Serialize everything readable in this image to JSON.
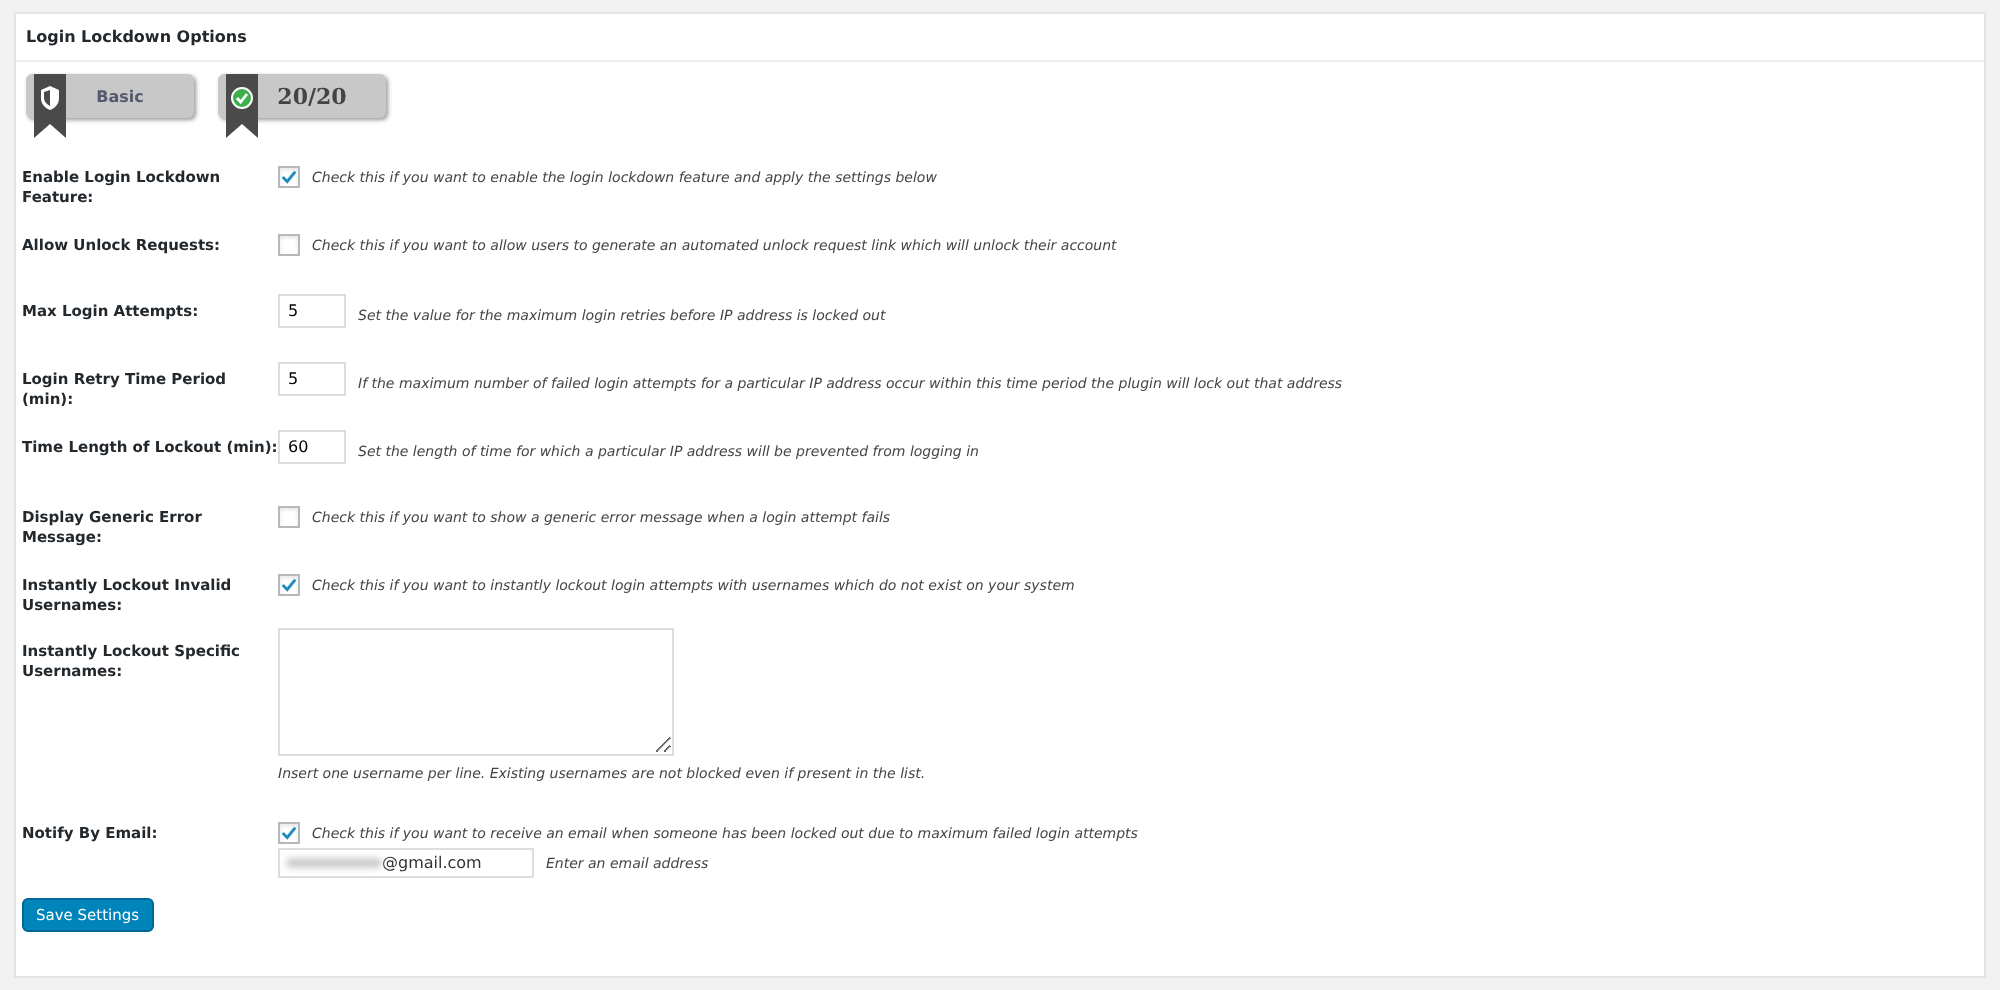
{
  "panel": {
    "title": "Login Lockdown Options"
  },
  "badges": [
    {
      "kind": "shield",
      "label": "Basic"
    },
    {
      "kind": "check",
      "label": "20/20"
    }
  ],
  "rows": [
    {
      "kind": "checkbox",
      "label": "Enable Login Lockdown Feature:",
      "checked": true,
      "description": "Check this if you want to enable the login lockdown feature and apply the settings below"
    },
    {
      "kind": "checkbox",
      "label": "Allow Unlock Requests:",
      "checked": false,
      "description": "Check this if you want to allow users to generate an automated unlock request link which will unlock their account"
    },
    {
      "kind": "number",
      "label": "Max Login Attempts:",
      "value": "5",
      "description": "Set the value for the maximum login retries before IP address is locked out"
    },
    {
      "kind": "number",
      "label": "Login Retry Time Period (min):",
      "value": "5",
      "description": "If the maximum number of failed login attempts for a particular IP address occur within this time period the plugin will lock out that address"
    },
    {
      "kind": "number",
      "label": "Time Length of Lockout (min):",
      "value": "60",
      "description": "Set the length of time for which a particular IP address will be prevented from logging in"
    },
    {
      "kind": "checkbox",
      "label": "Display Generic Error Message:",
      "checked": false,
      "description": "Check this if you want to show a generic error message when a login attempt fails"
    },
    {
      "kind": "checkbox",
      "label": "Instantly Lockout Invalid Usernames:",
      "checked": true,
      "description": "Check this if you want to instantly lockout login attempts with usernames which do not exist on your system"
    },
    {
      "kind": "textarea",
      "label": "Instantly Lockout Specific Usernames:",
      "description": "Insert one username per line. Existing usernames are not blocked even if present in the list."
    },
    {
      "kind": "email",
      "label": "Notify By Email:",
      "checked": true,
      "description": "Check this if you want to receive an email when someone has been locked out due to maximum failed login attempts",
      "value": "@gmail.com",
      "hint": "Enter an email address"
    }
  ],
  "save_button": "Save Settings"
}
